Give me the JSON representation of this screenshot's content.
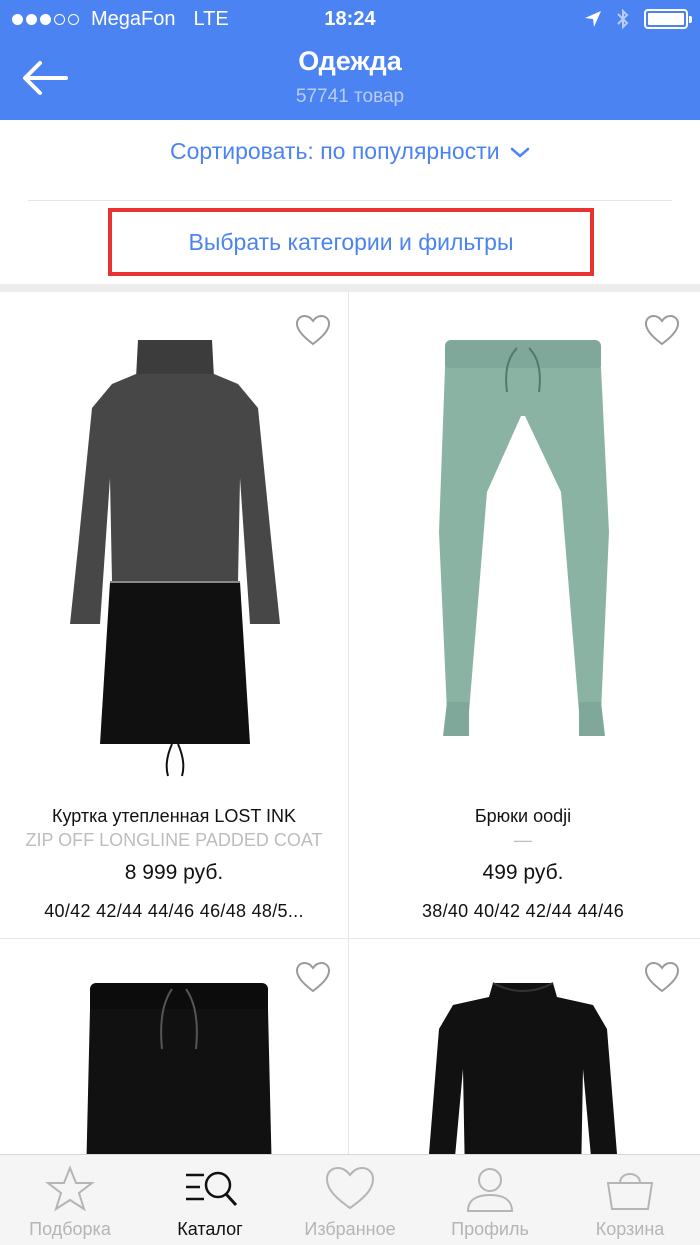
{
  "status_bar": {
    "carrier": "MegaFon",
    "network": "LTE",
    "time": "18:24",
    "signal_bars_filled": 3,
    "signal_bars_total": 5
  },
  "header": {
    "title": "Одежда",
    "subtitle": "57741 товар",
    "back_icon": "arrow-left-icon"
  },
  "sort": {
    "label": "Сортировать: по популярности"
  },
  "filter": {
    "label": "Выбрать категории и фильтры"
  },
  "products": [
    {
      "name": "Куртка утепленная LOST INK",
      "brand_line": "ZIP OFF LONGLINE PADDED COAT",
      "price": "8 999 руб.",
      "sizes": "40/42   42/44   44/46   46/48   48/5..."
    },
    {
      "name": "Брюки oodji",
      "brand_line": "—",
      "price": "499 руб.",
      "sizes": "38/40   40/42   42/44   44/46"
    },
    {
      "name": "",
      "brand_line": "",
      "price": "",
      "sizes": ""
    },
    {
      "name": "",
      "brand_line": "",
      "price": "",
      "sizes": ""
    }
  ],
  "tabs": [
    {
      "label": "Подборка",
      "icon": "star-icon",
      "active": false
    },
    {
      "label": "Каталог",
      "icon": "catalog-search-icon",
      "active": true
    },
    {
      "label": "Избранное",
      "icon": "heart-icon",
      "active": false
    },
    {
      "label": "Профиль",
      "icon": "user-icon",
      "active": false
    },
    {
      "label": "Корзина",
      "icon": "basket-icon",
      "active": false
    }
  ],
  "colors": {
    "header_bg": "#4b84f2",
    "accent": "#4b84f2",
    "highlight_border": "#e83232"
  }
}
